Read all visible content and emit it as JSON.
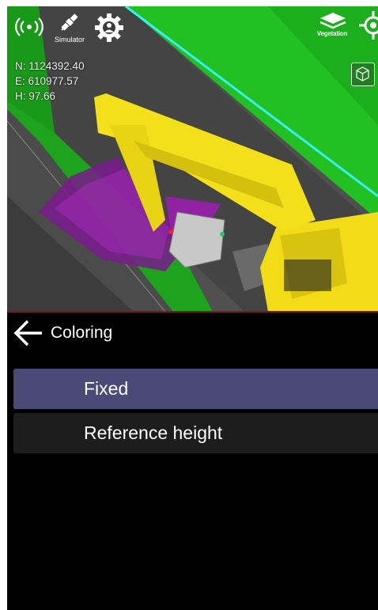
{
  "toolbar": {
    "signal_icon": "broadcast-signal-icon",
    "simulator_label": "Simulator",
    "settings_icon": "gear-person-icon",
    "vegetation_label": "Vegetation",
    "locate_icon": "crosshair-icon"
  },
  "coordinates": {
    "north": "N: 1124392.40",
    "east": "E: 610977.57",
    "height": "H: 97.66"
  },
  "view_cube_icon": "cube-icon",
  "panel": {
    "back_icon": "arrow-left-icon",
    "title": "Coloring",
    "options": [
      {
        "label": "Fixed",
        "selected": true
      },
      {
        "label": "Reference height",
        "selected": false
      }
    ]
  },
  "colors": {
    "accent_selected": "#4a4a78",
    "option_bg": "#1d1d1d",
    "excavator": "#f4e01a",
    "green_strip": "#1fb51f",
    "cyan_line": "#3ff0f0",
    "points": "#9a1fae"
  }
}
